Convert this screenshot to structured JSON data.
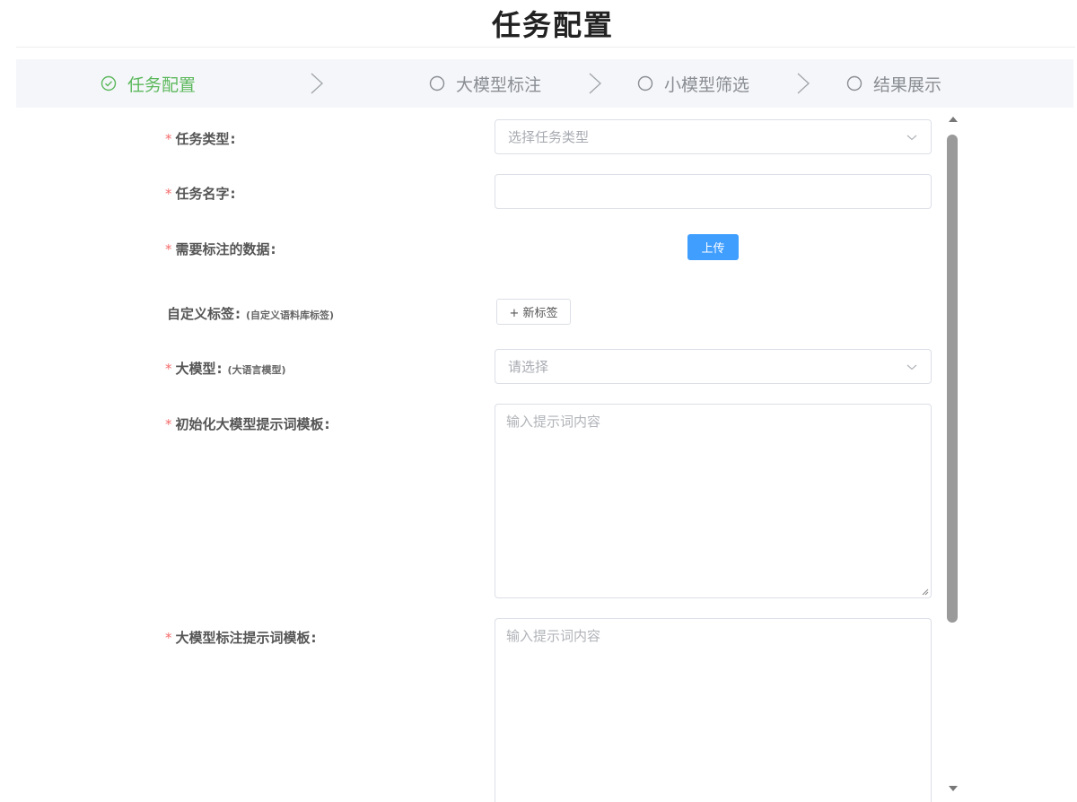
{
  "page": {
    "title": "任务配置"
  },
  "steps": [
    {
      "label": "任务配置",
      "state": "active"
    },
    {
      "label": "大模型标注",
      "state": "pending"
    },
    {
      "label": "小模型筛选",
      "state": "pending"
    },
    {
      "label": "结果展示",
      "state": "pending"
    }
  ],
  "form": {
    "task_type": {
      "label": "任务类型",
      "required": true,
      "placeholder": "选择任务类型"
    },
    "task_name": {
      "label": "任务名字",
      "required": true,
      "value": ""
    },
    "data": {
      "label": "需要标注的数据",
      "required": true,
      "button": "上传"
    },
    "custom_tags": {
      "label": "自定义标签",
      "required": false,
      "hint": "(自定义语料库标签)",
      "button": "+ 新标签"
    },
    "llm": {
      "label": "大模型",
      "required": true,
      "hint": "(大语言模型)",
      "placeholder": "请选择"
    },
    "init_prompt": {
      "label": "初始化大模型提示词模板",
      "required": true,
      "placeholder": "输入提示词内容"
    },
    "label_prompt": {
      "label": "大模型标注提示词模板",
      "required": true,
      "placeholder": "输入提示词内容"
    }
  },
  "theme": {
    "active_color": "#5cb85c",
    "primary_color": "#409eff",
    "required_color": "#f56c6c"
  }
}
